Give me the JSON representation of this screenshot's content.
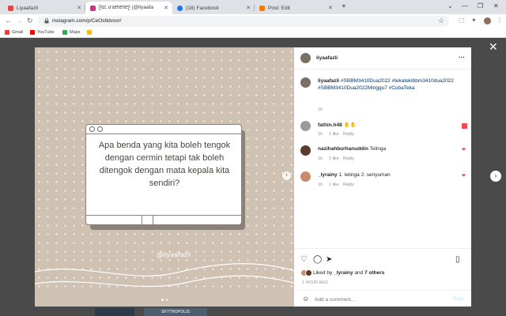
{
  "tabs": [
    {
      "label": "Liyaafazli",
      "color": "#e8453c"
    },
    {
      "label": "ᥫᥲᥴ ɑᥔᥱᥒᥱᥒᥱᥫ (@liyaafa",
      "color": "#c13584"
    },
    {
      "label": "(18) Facebook",
      "color": "#1877f2"
    },
    {
      "label": "Post: Edit",
      "color": "#f57d00"
    }
  ],
  "toolbar": {
    "url": "instagram.com/p/CeOstIdvxxr/"
  },
  "bookmarks": [
    {
      "label": "Gmail",
      "color": "#ea4335"
    },
    {
      "label": "YouTube",
      "color": "#ff0000"
    },
    {
      "label": "Maps",
      "color": "#34a853"
    },
    {
      "label": "",
      "color": "#fbbc04"
    }
  ],
  "post": {
    "username": "liyaafazli",
    "image_text": "Apa benda yang kita boleh tengok dengan cermin tetapi tak boleh ditengok dengan mata kepala kita sendiri?",
    "watermark": "@liyaafazli",
    "caption_user": "liyaafazli",
    "caption_tags": "#SBBM3410Dua2022 #tekatekibbm3410dua2022 #SBBM3410Dua2022Minggu7 #CubaTeka",
    "caption_age": "1h"
  },
  "comments": [
    {
      "user": "fathin.h48",
      "text": "✋✋",
      "age": "1h",
      "likes": "1 like",
      "reply": "Reply",
      "avatar": "#9a9a9a"
    },
    {
      "user": "nazihahburhanuddin",
      "text": "Telinga",
      "age": "1h",
      "likes": "1 like",
      "reply": "Reply",
      "avatar": "#5a3b2c"
    },
    {
      "user": "_lyrainy",
      "text": "1. telinga 2. senyuman",
      "age": "1h",
      "likes": "1 like",
      "reply": "Reply",
      "avatar": "#c98b6b"
    }
  ],
  "actions": {
    "liked_by_prefix": "Liked by ",
    "liked_by_user": "_lyrainy",
    "liked_by_mid": " and ",
    "liked_by_others": "7 others",
    "time_ago": "1 HOUR AGO",
    "comment_placeholder": "Add a comment...",
    "post_label": "Post"
  }
}
